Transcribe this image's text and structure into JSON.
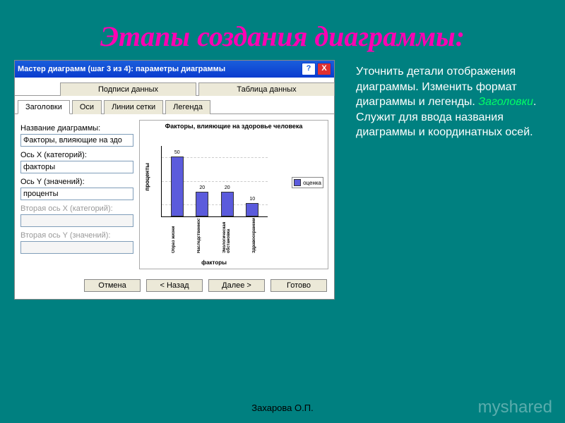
{
  "slide": {
    "title": "Этапы создания диаграммы:",
    "footer": "Захарова О.П.",
    "watermark": "myshared"
  },
  "dialog": {
    "title": "Мастер диаграмм (шаг 3 из 4): параметры диаграммы",
    "help_btn": "?",
    "close_btn": "X",
    "tabs_top": [
      "Подписи данных",
      "Таблица данных"
    ],
    "tabs_bottom": [
      "Заголовки",
      "Оси",
      "Линии сетки",
      "Легенда"
    ],
    "fields": {
      "chart_title_label": "Название диаграммы:",
      "chart_title_value": "Факторы, влияющие на здо",
      "x_label": "Ось X (категорий):",
      "x_value": "факторы",
      "y_label": "Ось Y (значений):",
      "y_value": "проценты",
      "x2_label": "Вторая ось X (категорий):",
      "x2_value": "",
      "y2_label": "Вторая ось Y (значений):",
      "y2_value": ""
    },
    "buttons": {
      "cancel": "Отмена",
      "back": "< Назад",
      "next": "Далее >",
      "finish": "Готово"
    }
  },
  "explain": {
    "p1": "Уточнить детали отображения диаграммы. Изменить формат диаграммы и легенды.",
    "hl": "Заголовки",
    "p2": ". Служит для ввода названия диаграммы и координатных осей."
  },
  "chart_data": {
    "type": "bar",
    "title": "Факторы, влияющие на здоровье человека",
    "xlabel": "факторы",
    "ylabel": "проценты",
    "categories": [
      "Образ жизни",
      "Наследственность",
      "Экологическая обстановка",
      "Здравоохранение"
    ],
    "values": [
      50,
      20,
      20,
      10
    ],
    "ylim": [
      0,
      60
    ],
    "series": [
      {
        "name": "оценка",
        "values": [
          50,
          20,
          20,
          10
        ]
      }
    ],
    "legend": "оценка"
  }
}
